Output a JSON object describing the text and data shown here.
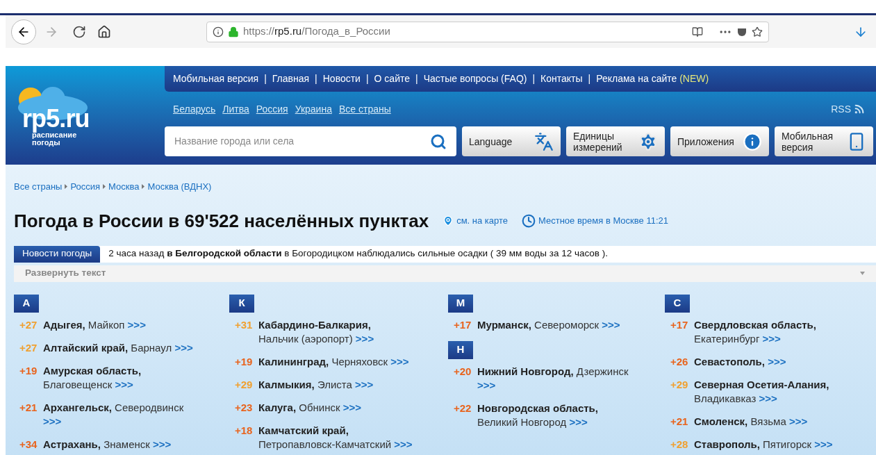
{
  "browser": {
    "url_host": "rp5.ru",
    "url_scheme": "https://",
    "url_path": "/Погода_в_России"
  },
  "logo": {
    "name": "rp5.ru",
    "tagline": "расписание погоды"
  },
  "nav": [
    {
      "label": "Мобильная версия"
    },
    {
      "label": "Главная"
    },
    {
      "label": "Новости"
    },
    {
      "label": "О сайте"
    },
    {
      "label": "Частые вопросы (FAQ)"
    },
    {
      "label": "Контакты"
    },
    {
      "label": "Реклама на сайте",
      "badge": "(NEW)"
    }
  ],
  "nav_separator": "|",
  "countries": [
    "Беларусь",
    "Литва",
    "Россия",
    "Украина",
    "Все страны"
  ],
  "rss": "RSS",
  "search": {
    "placeholder": "Название города или села"
  },
  "tools": [
    {
      "kind": "language",
      "label": "Language"
    },
    {
      "kind": "units",
      "label": "Единицы измерений"
    },
    {
      "kind": "apps",
      "label": "Приложения"
    },
    {
      "kind": "mobile",
      "label": "Мобильная версия"
    }
  ],
  "breadcrumbs": [
    "Все страны",
    "Россия",
    "Москва",
    "Москва (ВДНХ)"
  ],
  "title": "Погода в России в 69'522 населённых пунктах",
  "map_link": "см. на карте",
  "local_time": {
    "label": "Местное время в Москве",
    "time": "11:21"
  },
  "news": {
    "tag": "Новости погоды",
    "text": "2 часа назад **в Белгородской области** в Богородицком наблюдались сильные осадки ( 39 мм воды за 12 часов ).",
    "expand": "Развернуть текст"
  },
  "columns": [
    [
      {
        "letter": "А",
        "items": [
          {
            "temp": "+27",
            "color": "#f0a030",
            "region": "Адыгея,",
            "city": "Майкоп",
            "link": ">>>"
          },
          {
            "temp": "+27",
            "color": "#f0a030",
            "region": "Алтайский край,",
            "city": "Барнаул",
            "link": ">>>"
          },
          {
            "temp": "+19",
            "color": "#e8641e",
            "region": "Амурская область,",
            "city": "Благовещенск",
            "link": ">>>"
          },
          {
            "temp": "+21",
            "color": "#e8641e",
            "region": "Архангельск,",
            "city": "Северодвинск",
            "link": ">>>"
          },
          {
            "temp": "+34",
            "color": "#e8641e",
            "region": "Астрахань,",
            "city": "Знаменск",
            "link": ">>>"
          }
        ]
      }
    ],
    [
      {
        "letter": "К",
        "items": [
          {
            "temp": "+31",
            "color": "#f0a030",
            "region": "Кабардино-Балкария,",
            "city": "Нальчик (аэропорт)",
            "link": ">>>"
          },
          {
            "temp": "+19",
            "color": "#e8641e",
            "region": "Калининград,",
            "city": "Черняховск",
            "link": ">>>"
          },
          {
            "temp": "+29",
            "color": "#f0a030",
            "region": "Калмыкия,",
            "city": "Элиста",
            "link": ">>>"
          },
          {
            "temp": "+23",
            "color": "#e8641e",
            "region": "Калуга,",
            "city": "Обнинск",
            "link": ">>>"
          },
          {
            "temp": "+18",
            "color": "#e8641e",
            "region": "Камчатский край,",
            "city": "Петропавловск-Камчатский",
            "link": ">>>"
          }
        ]
      }
    ],
    [
      {
        "letter": "М",
        "items": [
          {
            "temp": "+17",
            "color": "#e8641e",
            "region": "Мурманск,",
            "city": "Североморск",
            "link": ">>>"
          }
        ]
      },
      {
        "letter": "Н",
        "items": [
          {
            "temp": "+20",
            "color": "#e8641e",
            "region": "Нижний Новгород,",
            "city": "Дзержинск",
            "link": ">>>"
          },
          {
            "temp": "+22",
            "color": "#e8641e",
            "region": "Новгородская область,",
            "city": "Великий Новгород",
            "link": ">>>"
          }
        ]
      }
    ],
    [
      {
        "letter": "С",
        "items": [
          {
            "temp": "+17",
            "color": "#e8641e",
            "region": "Свердловская область,",
            "city": "Екатеринбург",
            "link": ">>>"
          },
          {
            "temp": "+26",
            "color": "#e8641e",
            "region": "Севастополь,",
            "link": ">>>"
          },
          {
            "temp": "+29",
            "color": "#f0a030",
            "region": "Северная Осетия-Алания,",
            "city": "Владикавказ",
            "link": ">>>"
          },
          {
            "temp": "+21",
            "color": "#e8641e",
            "region": "Смоленск,",
            "city": "Вязьма",
            "link": ">>>"
          },
          {
            "temp": "+28",
            "color": "#f0a030",
            "region": "Ставрополь,",
            "city": "Пятигорск",
            "link": ">>>"
          }
        ]
      }
    ]
  ]
}
